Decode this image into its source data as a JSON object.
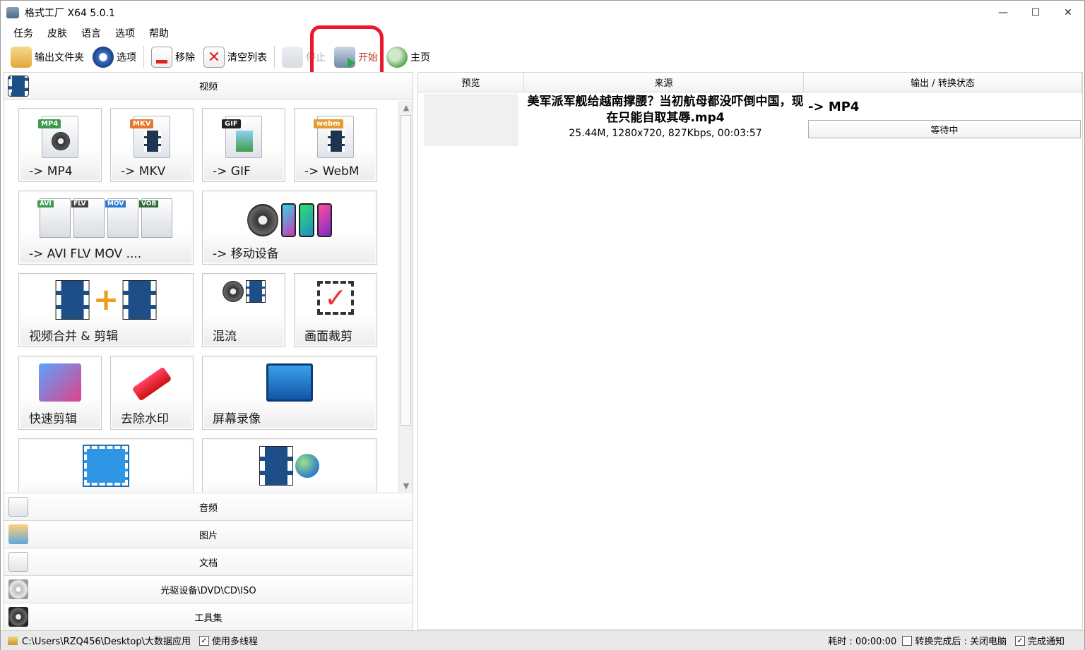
{
  "window": {
    "title": "格式工厂 X64 5.0.1",
    "controls": [
      "—",
      "☐",
      "✕"
    ]
  },
  "menu": [
    "任务",
    "皮肤",
    "语言",
    "选项",
    "帮助"
  ],
  "toolbar": {
    "output_folder": "输出文件夹",
    "options": "选项",
    "remove": "移除",
    "clear_list": "清空列表",
    "stop": "停止",
    "start": "开始",
    "home": "主页"
  },
  "categories": {
    "video": "视频",
    "audio": "音频",
    "image": "图片",
    "document": "文档",
    "disc": "光驱设备\\DVD\\CD\\ISO",
    "tools": "工具集"
  },
  "video_tiles": {
    "mp4": {
      "label": "-> MP4",
      "tag": "MP4"
    },
    "mkv": {
      "label": "-> MKV",
      "tag": "MKV"
    },
    "gif": {
      "label": "-> GIF",
      "tag": "GIF"
    },
    "webm": {
      "label": "-> WebM",
      "tag": "webm"
    },
    "avi": {
      "label": "-> AVI FLV MOV ....",
      "tags": [
        "AVI",
        "FLV",
        "MOV",
        "VOB"
      ]
    },
    "mobile": {
      "label": "-> 移动设备"
    },
    "merge": {
      "label": "视频合并 & 剪辑"
    },
    "mux": {
      "label": "混流"
    },
    "crop": {
      "label": "画面裁剪"
    },
    "quick": {
      "label": "快速剪辑"
    },
    "watermark": {
      "label": "去除水印"
    },
    "screen": {
      "label": "屏幕录像"
    }
  },
  "table": {
    "headers": [
      "预览",
      "来源",
      "输出 / 转换状态"
    ],
    "rows": [
      {
        "source_name": "美军派军舰给越南撑腰？当初航母都没吓倒中国，现在只能自取其辱.mp4",
        "source_meta": "25.44M, 1280x720, 827Kbps, 00:03:57",
        "output_format": "-> MP4",
        "status": "等待中"
      }
    ]
  },
  "statusbar": {
    "path": "C:\\Users\\RZQ456\\Desktop\\大数据应用",
    "multithread": "使用多线程",
    "elapsed": "耗时 : 00:00:00",
    "after_convert": "转换完成后 : 关闭电脑",
    "notify": "完成通知"
  }
}
